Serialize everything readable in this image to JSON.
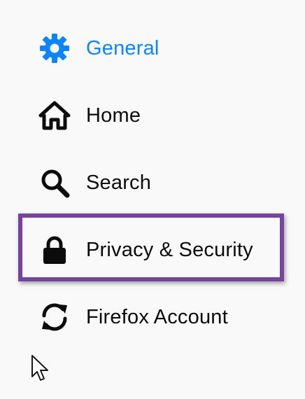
{
  "sidebar": {
    "items": [
      {
        "label": "General",
        "icon": "gear-icon",
        "selected": true
      },
      {
        "label": "Home",
        "icon": "home-icon",
        "selected": false
      },
      {
        "label": "Search",
        "icon": "search-icon",
        "selected": false
      },
      {
        "label": "Privacy & Security",
        "icon": "lock-icon",
        "selected": false
      },
      {
        "label": "Firefox Account",
        "icon": "sync-icon",
        "selected": false
      }
    ]
  },
  "colors": {
    "background": "#f9f9fa",
    "selected_text": "#0a84ff",
    "text": "#0c0c0d",
    "highlight_border": "#76439f"
  }
}
